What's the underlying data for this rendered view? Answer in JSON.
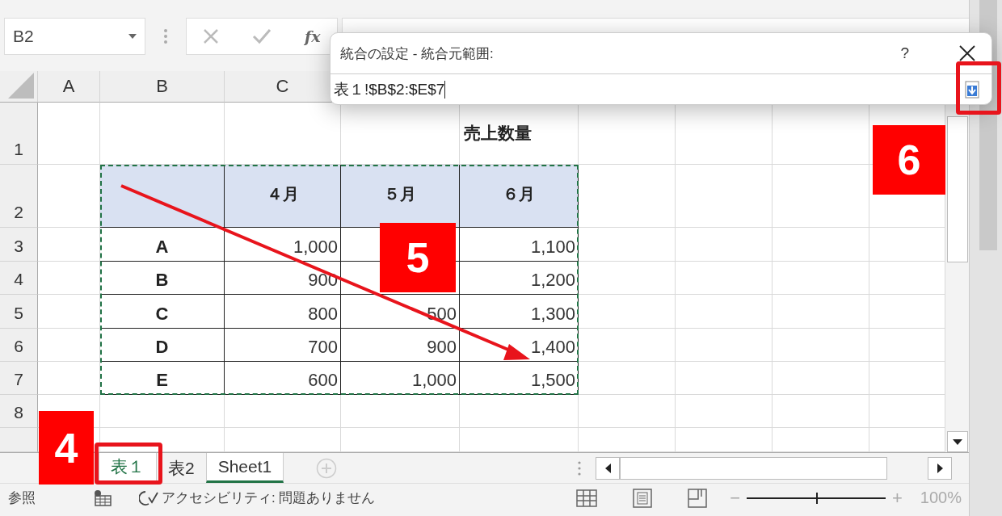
{
  "name_box": {
    "value": "B2"
  },
  "formula_bar": {
    "function_label": "fx"
  },
  "dialog": {
    "title": "統合の設定 - 統合元範囲:",
    "help": "?",
    "value": "表１!$B$2:$E$7"
  },
  "columns": [
    "A",
    "B",
    "C"
  ],
  "row_numbers": [
    "1",
    "2",
    "3",
    "4",
    "5",
    "6",
    "7",
    "8"
  ],
  "sheet": {
    "title": "売上数量"
  },
  "table": {
    "header": [
      "４月",
      "５月",
      "６月"
    ],
    "rows": [
      {
        "label": "A",
        "month_4": "1,000",
        "month_6": "1,100"
      },
      {
        "label": "B",
        "month_4": "900",
        "month_6": "1,200"
      },
      {
        "label": "C",
        "month_4": "800",
        "month_5": "500",
        "month_6": "1,300"
      },
      {
        "label": "D",
        "month_4": "700",
        "month_5": "900",
        "month_6": "1,400"
      },
      {
        "label": "E",
        "month_4": "600",
        "month_5": "1,000",
        "month_6": "1,500"
      }
    ]
  },
  "sheet_tabs": [
    {
      "label": "表１",
      "selected": true,
      "grouped": true
    },
    {
      "label": "表2",
      "selected": false,
      "grouped": false
    },
    {
      "label": "Sheet1",
      "selected": false,
      "grouped": true
    }
  ],
  "status_bar": {
    "mode": "参照",
    "accessibility": "アクセシビリティ: 問題ありません",
    "zoom_out": "−",
    "zoom_in": "+",
    "zoom": {
      "level": 0.5
    },
    "zoom_text": "100%"
  },
  "annotations": [
    {
      "label": "4"
    },
    {
      "label": "5"
    },
    {
      "label": "6"
    }
  ]
}
